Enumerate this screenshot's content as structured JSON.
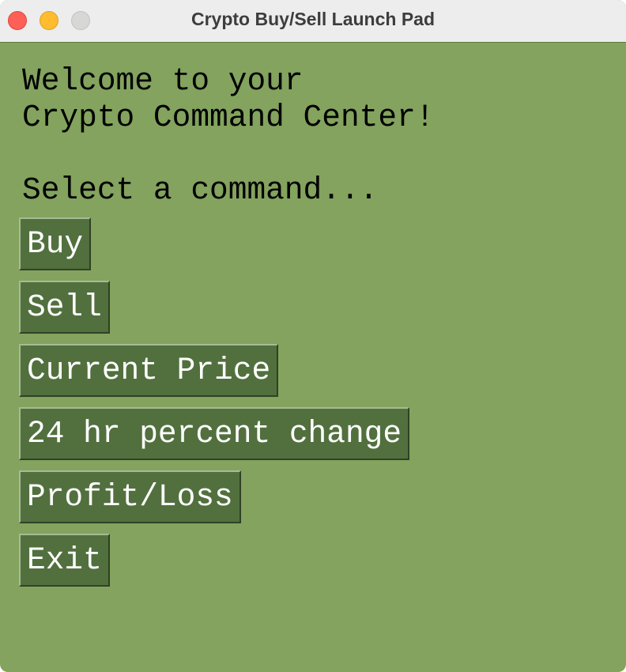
{
  "window": {
    "title": "Crypto Buy/Sell Launch Pad",
    "controls": [
      "close",
      "minimize",
      "maximize"
    ],
    "background_color": "#83a35e"
  },
  "main": {
    "heading_line1": "Welcome to your",
    "heading_line2": "Crypto Command Center!",
    "prompt": "Select a command...",
    "buttons": [
      {
        "label": "Buy"
      },
      {
        "label": "Sell"
      },
      {
        "label": "Current Price"
      },
      {
        "label": "24 hr percent change"
      },
      {
        "label": "Profit/Loss"
      },
      {
        "label": "Exit"
      }
    ],
    "button_color": "#52703e",
    "button_text_color": "#ffffff"
  }
}
